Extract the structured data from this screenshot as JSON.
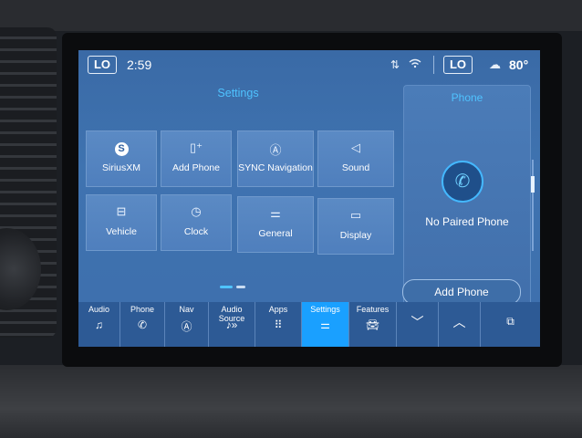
{
  "status_bar": {
    "left_climate": "LO",
    "time": "2:59",
    "right_climate": "LO",
    "temperature": "80°"
  },
  "settings": {
    "title": "Settings",
    "tiles": [
      {
        "label": "SiriusXM",
        "icon": "siriusxm-icon"
      },
      {
        "label": "Add Phone",
        "icon": "add-phone-icon"
      },
      {
        "label": "SYNC Navigation",
        "icon": "navigation-icon"
      },
      {
        "label": "Sound",
        "icon": "speaker-icon"
      },
      {
        "label": "Vehicle",
        "icon": "vehicle-icon"
      },
      {
        "label": "Clock",
        "icon": "clock-icon"
      },
      {
        "label": "General",
        "icon": "sliders-icon"
      },
      {
        "label": "Display",
        "icon": "display-icon"
      }
    ]
  },
  "phone_panel": {
    "title": "Phone",
    "status": "No Paired Phone",
    "button": "Add Phone"
  },
  "nav": {
    "items": [
      {
        "label": "Audio",
        "icon": "music-note-icon"
      },
      {
        "label": "Phone",
        "icon": "phone-icon"
      },
      {
        "label": "Nav",
        "icon": "navigation-icon"
      },
      {
        "label": "Audio Source",
        "icon": "audio-source-icon"
      },
      {
        "label": "Apps",
        "icon": "apps-grid-icon"
      },
      {
        "label": "Settings",
        "icon": "settings-sliders-icon",
        "active": true
      },
      {
        "label": "Features",
        "icon": "car-icon"
      }
    ],
    "extra": [
      "chevron-down-icon",
      "chevron-up-icon",
      "windows-icon"
    ]
  },
  "colors": {
    "accent": "#1aa0ff",
    "title_blue": "#4fc3ff",
    "screen_bg": "#3d6fad"
  }
}
